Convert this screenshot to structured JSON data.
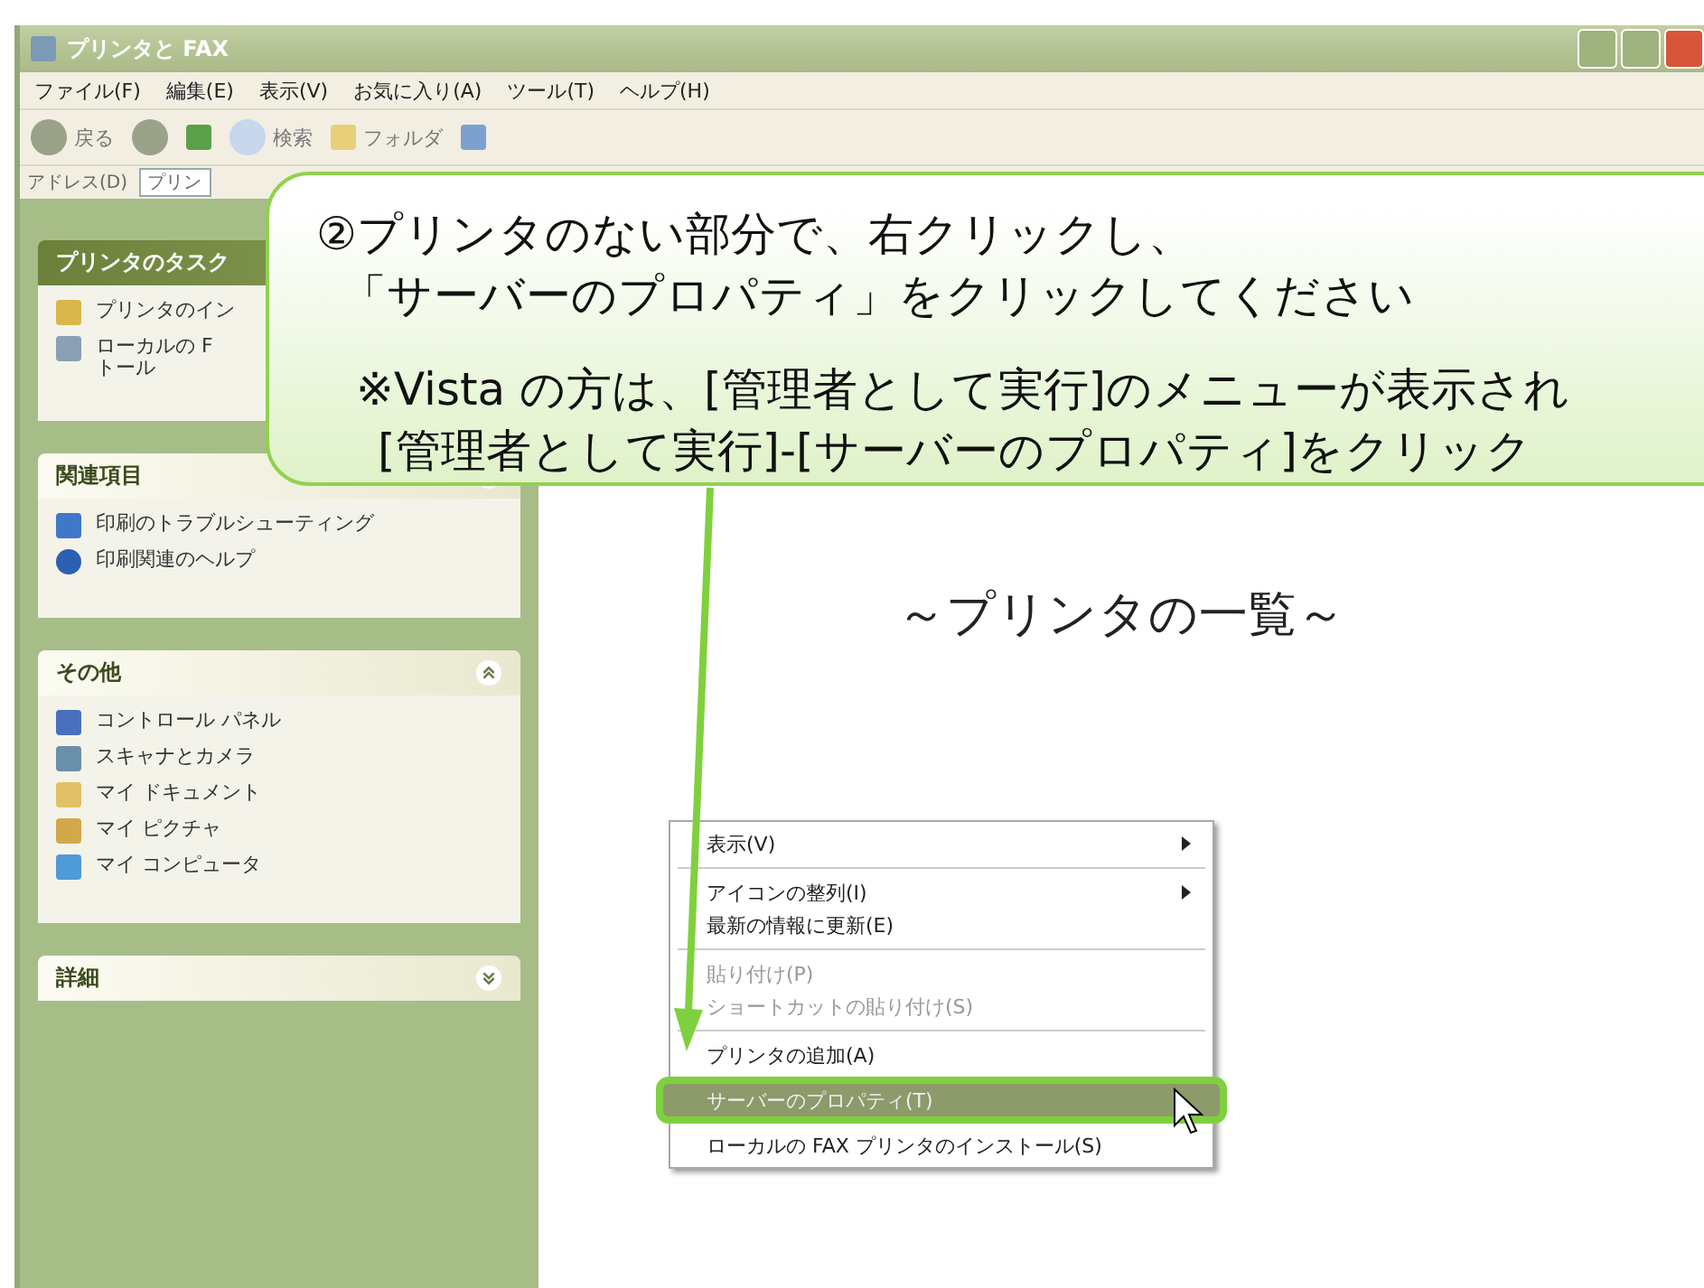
{
  "window": {
    "title": "プリンタと FAX"
  },
  "menu_bar": [
    "ファイル(F)",
    "編集(E)",
    "表示(V)",
    "お気に入り(A)",
    "ツール(T)",
    "ヘルプ(H)"
  ],
  "toolbar": {
    "back": "戻る",
    "search": "検索",
    "folders": "フォルダ"
  },
  "address_bar": {
    "label": "アドレス(D)",
    "value": "プリン"
  },
  "sidebar": {
    "sections": [
      {
        "title": "プリンタのタスク",
        "kind": "special",
        "expanded": true,
        "items": [
          {
            "label": "プリンタのイン"
          },
          {
            "label": "ローカルの F\nトール"
          }
        ]
      },
      {
        "title": "関連項目",
        "kind": "normal",
        "expanded": true,
        "items": [
          {
            "label": "印刷のトラブルシューティング"
          },
          {
            "label": "印刷関連のヘルプ"
          }
        ]
      },
      {
        "title": "その他",
        "kind": "normal",
        "expanded": true,
        "items": [
          {
            "label": "コントロール パネル"
          },
          {
            "label": "スキャナとカメラ"
          },
          {
            "label": "マイ ドキュメント"
          },
          {
            "label": "マイ ピクチャ"
          },
          {
            "label": "マイ コンピュータ"
          }
        ]
      },
      {
        "title": "詳細",
        "kind": "normal",
        "expanded": false
      }
    ]
  },
  "content": {
    "heading": "～プリンタの一覧～"
  },
  "context_menu": [
    {
      "kind": "item",
      "label": "表示(V)",
      "submenu": true,
      "disabled": false,
      "selected": false
    },
    {
      "kind": "separator"
    },
    {
      "kind": "item",
      "label": "アイコンの整列(I)",
      "submenu": true,
      "disabled": false,
      "selected": false
    },
    {
      "kind": "item",
      "label": "最新の情報に更新(E)",
      "submenu": false,
      "disabled": false,
      "selected": false
    },
    {
      "kind": "separator"
    },
    {
      "kind": "item",
      "label": "貼り付け(P)",
      "submenu": false,
      "disabled": true,
      "selected": false
    },
    {
      "kind": "item",
      "label": "ショートカットの貼り付け(S)",
      "submenu": false,
      "disabled": true,
      "selected": false
    },
    {
      "kind": "separator"
    },
    {
      "kind": "item",
      "label": "プリンタの追加(A)",
      "submenu": false,
      "disabled": false,
      "selected": false
    },
    {
      "kind": "item",
      "label": "サーバーのプロパティ(T)",
      "submenu": false,
      "disabled": false,
      "selected": true
    },
    {
      "kind": "item",
      "label": "ローカルの FAX プリンタのインストール(S)",
      "submenu": false,
      "disabled": false,
      "selected": false
    }
  ],
  "callout": {
    "paragraphs": [
      [
        "②プリンタのない部分で、右クリックし、",
        "「サーバーのプロパティ」をクリックしてください"
      ],
      [
        "※Vista の方は、[管理者として実行]のメニューが表示され",
        "[管理者として実行]-[サーバーのプロパティ]をクリック"
      ]
    ]
  }
}
